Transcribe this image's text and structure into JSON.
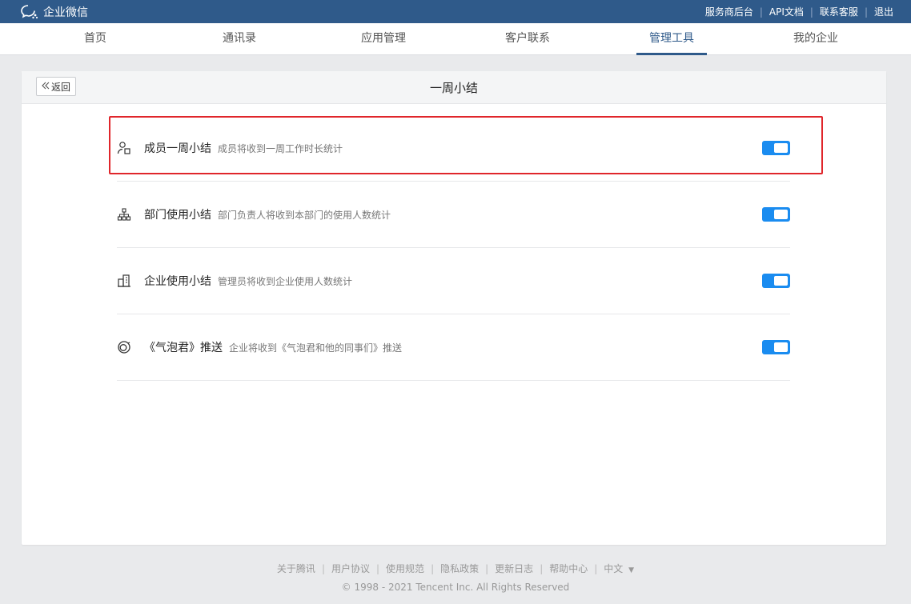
{
  "topbar": {
    "logo_text": "企业微信",
    "links": [
      "服务商后台",
      "API文档",
      "联系客服",
      "退出"
    ],
    "bg_color": "#2f5a8a"
  },
  "nav": {
    "items": [
      "首页",
      "通讯录",
      "应用管理",
      "客户联系",
      "管理工具",
      "我的企业"
    ],
    "active_index": 4
  },
  "panel": {
    "back_label": "返回",
    "title": "一周小结"
  },
  "items": [
    {
      "icon": "member-icon",
      "name": "成员一周小结",
      "desc": "成员将收到一周工作时长统计",
      "enabled": true,
      "highlighted": true
    },
    {
      "icon": "org-chart-icon",
      "name": "部门使用小结",
      "desc": "部门负责人将收到本部门的使用人数统计",
      "enabled": true,
      "highlighted": false
    },
    {
      "icon": "building-icon",
      "name": "企业使用小结",
      "desc": "管理员将收到企业使用人数统计",
      "enabled": true,
      "highlighted": false
    },
    {
      "icon": "bubble-icon",
      "name": "《气泡君》推送",
      "desc": "企业将收到《气泡君和他的同事们》推送",
      "enabled": true,
      "highlighted": false
    }
  ],
  "colors": {
    "toggle_on": "#1a8cf0",
    "highlight_border": "#e0262b"
  },
  "footer": {
    "links": [
      "关于腾讯",
      "用户协议",
      "使用规范",
      "隐私政策",
      "更新日志",
      "帮助中心"
    ],
    "language": "中文",
    "copyright": "© 1998 - 2021 Tencent Inc. All Rights Reserved"
  }
}
